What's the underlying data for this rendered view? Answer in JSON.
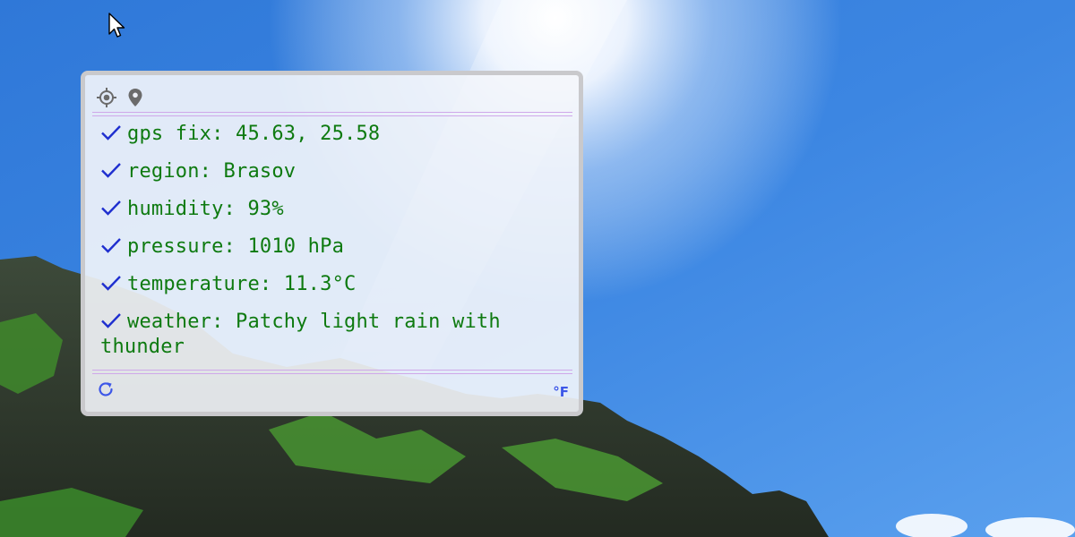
{
  "desktop": {
    "wallpaper": "mountain-and-sky",
    "sky_color": "#3f86dd"
  },
  "widget": {
    "header_icons": [
      "locate-icon",
      "map-pin-icon"
    ],
    "items": [
      "gps fix: 45.63, 25.58",
      "region: Brasov",
      "humidity: 93%",
      "pressure: 1010 hPa",
      "temperature: 11.3°C",
      "weather: Patchy light rain with thunder"
    ],
    "footer": {
      "refresh_icon": "refresh-icon",
      "unit_toggle": "°F"
    },
    "colors": {
      "text": "#0e7a10",
      "check": "#1f2fcf",
      "accent": "#3d57e8",
      "divider": "#cfa8ea"
    }
  }
}
